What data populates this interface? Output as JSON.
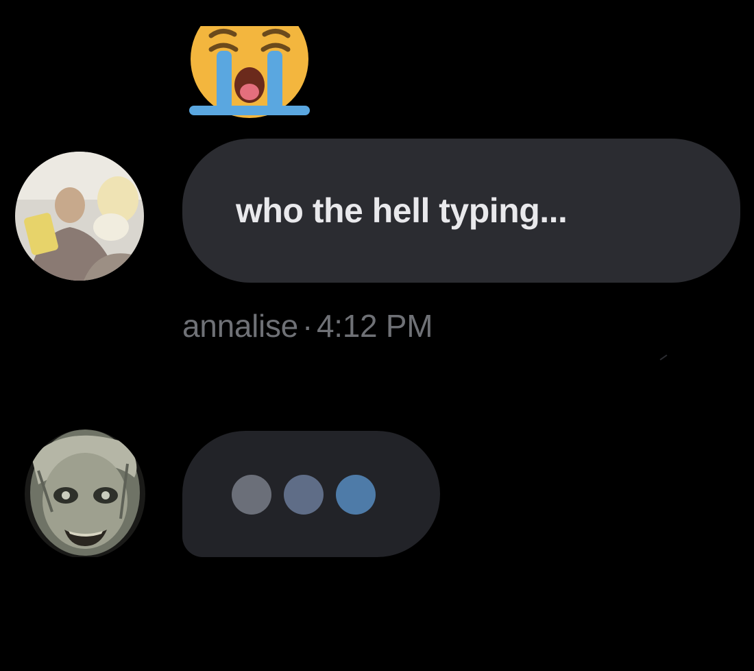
{
  "reaction": {
    "icon": "crying-face-icon"
  },
  "messages": [
    {
      "text": "who the hell typing...",
      "author": "annalise",
      "separator": "·",
      "time": "4:12 PM",
      "avatar_icon": "user-avatar"
    }
  ],
  "typing": {
    "avatar_icon": "user-avatar",
    "dot_colors": [
      "#6b6f79",
      "#5f6d87",
      "#4e7ba8"
    ]
  },
  "colors": {
    "background": "#000000",
    "bubble": "#2b2c31",
    "typing_bubble": "#222328",
    "text": "#e9e9ec",
    "meta_text": "#6f7176"
  }
}
